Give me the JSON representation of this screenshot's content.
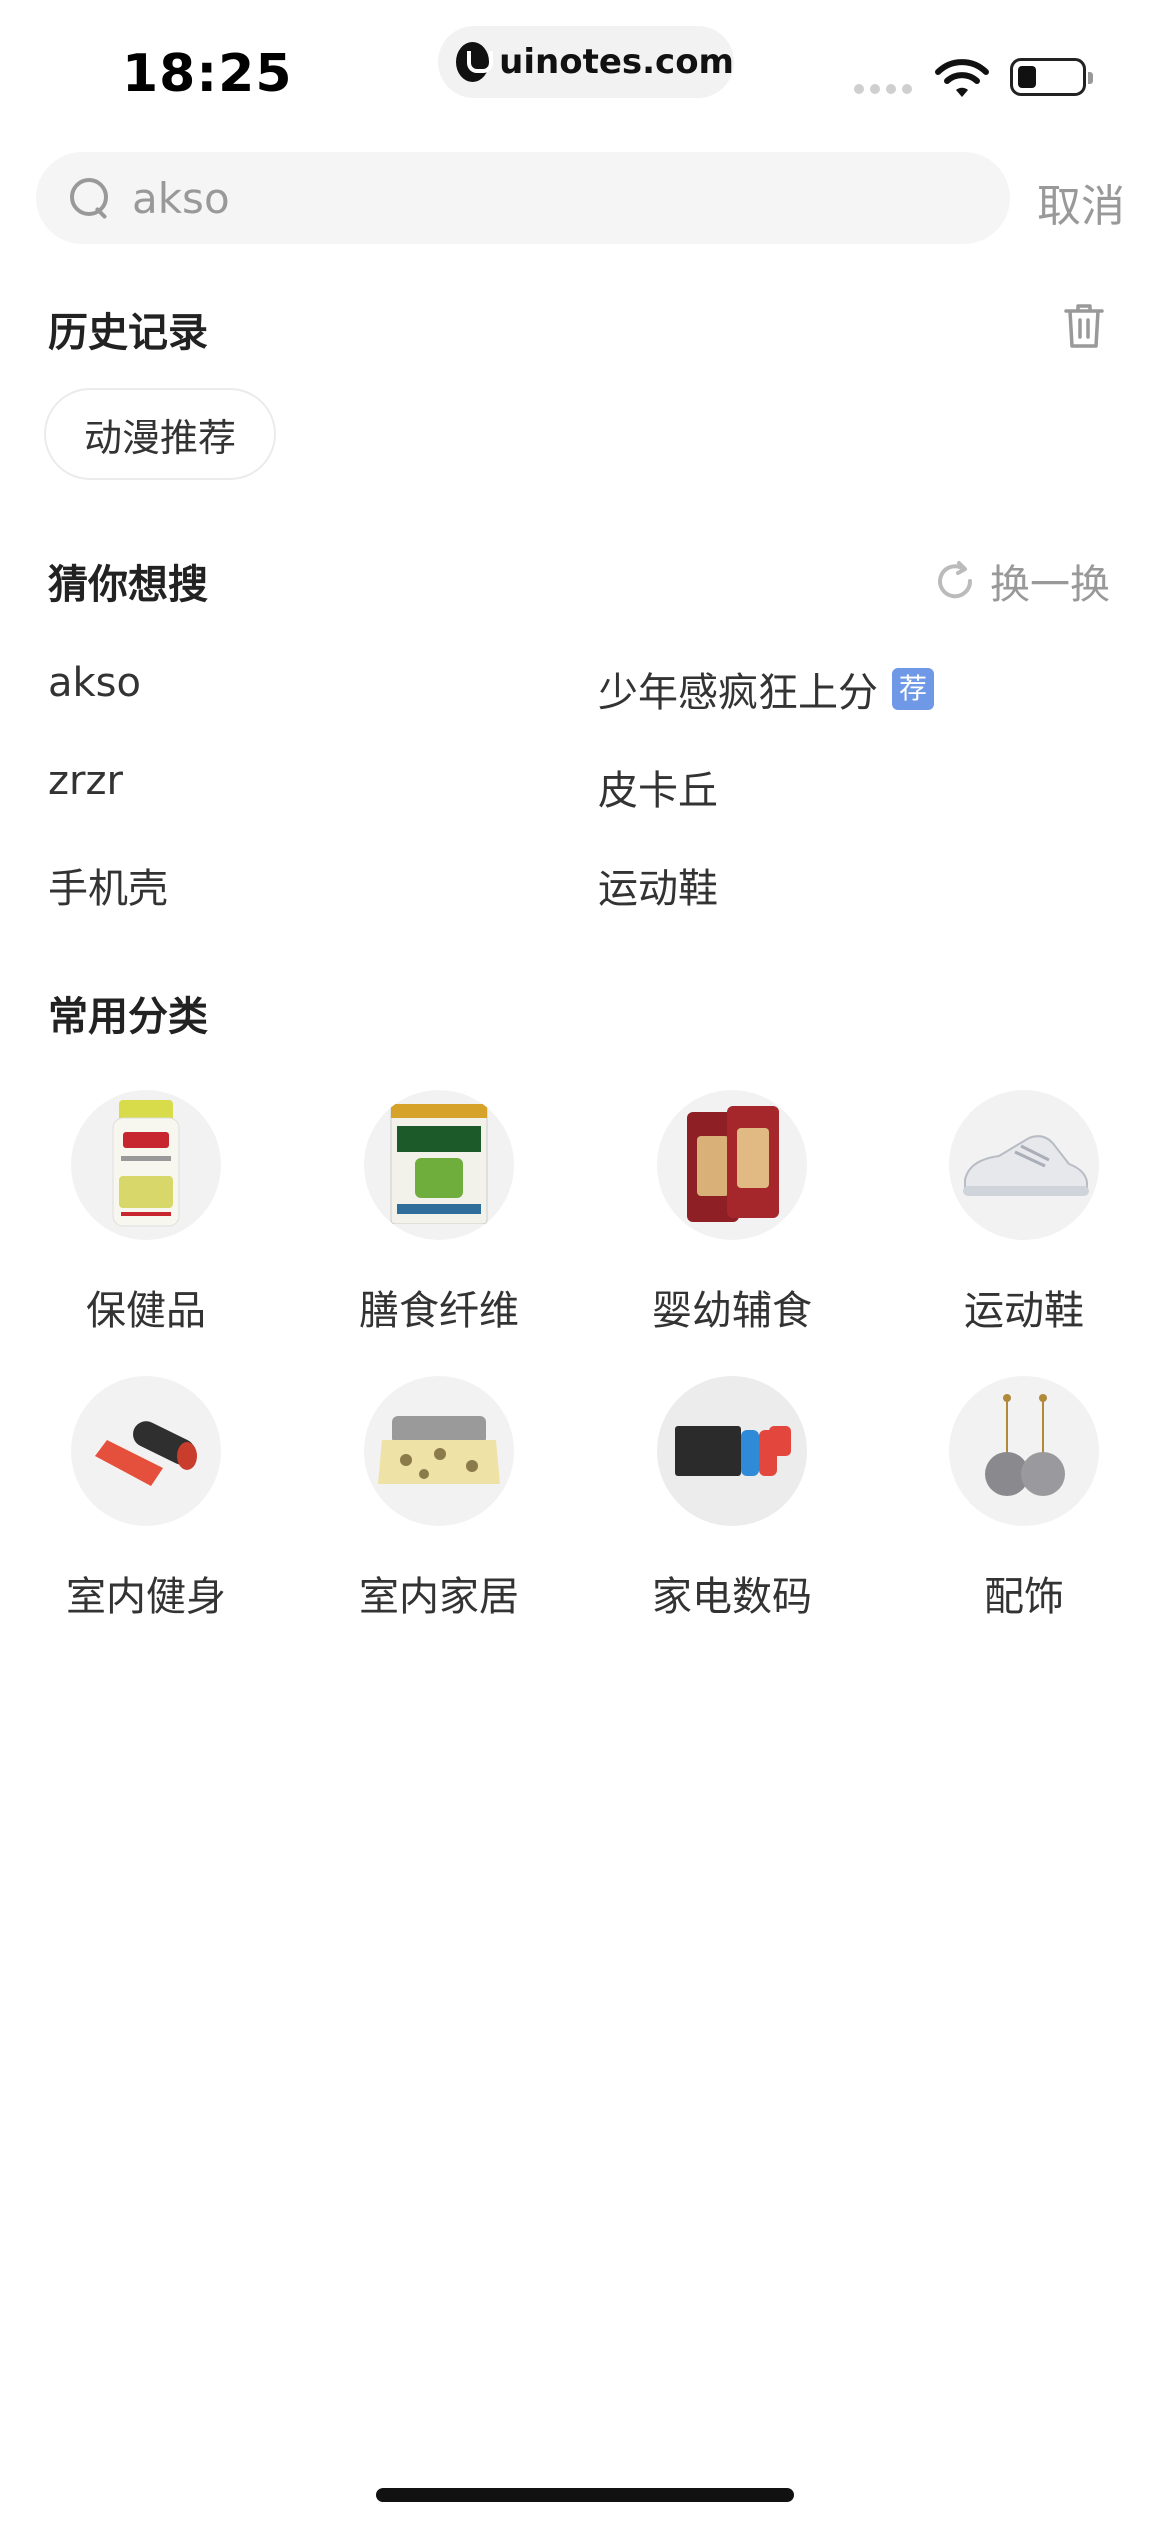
{
  "status_bar": {
    "time": "18:25",
    "url": "uinotes.com"
  },
  "search": {
    "value": "akso",
    "cancel_label": "取消"
  },
  "history": {
    "title": "历史记录",
    "items": [
      "动漫推荐"
    ]
  },
  "guess": {
    "title": "猜你想搜",
    "refresh_label": "换一换",
    "items": [
      {
        "label": "akso"
      },
      {
        "label": "少年感疯狂上分",
        "badge": "荐"
      },
      {
        "label": "zrzr"
      },
      {
        "label": "皮卡丘"
      },
      {
        "label": "手机壳"
      },
      {
        "label": "运动鞋"
      }
    ]
  },
  "categories": {
    "title": "常用分类",
    "items": [
      {
        "label": "保健品",
        "icon": "supplement-bottle-icon"
      },
      {
        "label": "膳食纤维",
        "icon": "fiber-box-icon"
      },
      {
        "label": "婴幼辅食",
        "icon": "baby-food-bags-icon"
      },
      {
        "label": "运动鞋",
        "icon": "sneaker-icon"
      },
      {
        "label": "室内健身",
        "icon": "yoga-mat-icon"
      },
      {
        "label": "室内家居",
        "icon": "bedding-icon"
      },
      {
        "label": "家电数码",
        "icon": "game-console-icon"
      },
      {
        "label": "配饰",
        "icon": "earrings-icon"
      }
    ]
  },
  "colors": {
    "accent_badge": "#6f99e6",
    "muted": "#999999",
    "chip_border": "#ebebeb"
  }
}
